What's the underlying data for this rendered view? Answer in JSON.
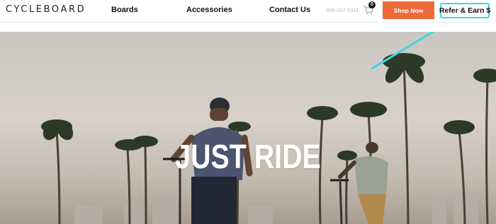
{
  "header": {
    "logo": "CYCLEBOARD",
    "nav": {
      "boards": "Boards",
      "accessories": "Accessories",
      "contact": "Contact Us"
    },
    "phone": "800-317-0311",
    "cart_count": "0",
    "shop_now": "Shop Now",
    "refer_earn": "Refer & Earn $"
  },
  "hero": {
    "headline": "JUST RIDE"
  },
  "colors": {
    "accent_orange": "#ee6a3a",
    "highlight_cyan": "#3dd6e6"
  },
  "icons": {
    "cart": "cart-icon",
    "arrow": "annotation-arrow"
  }
}
